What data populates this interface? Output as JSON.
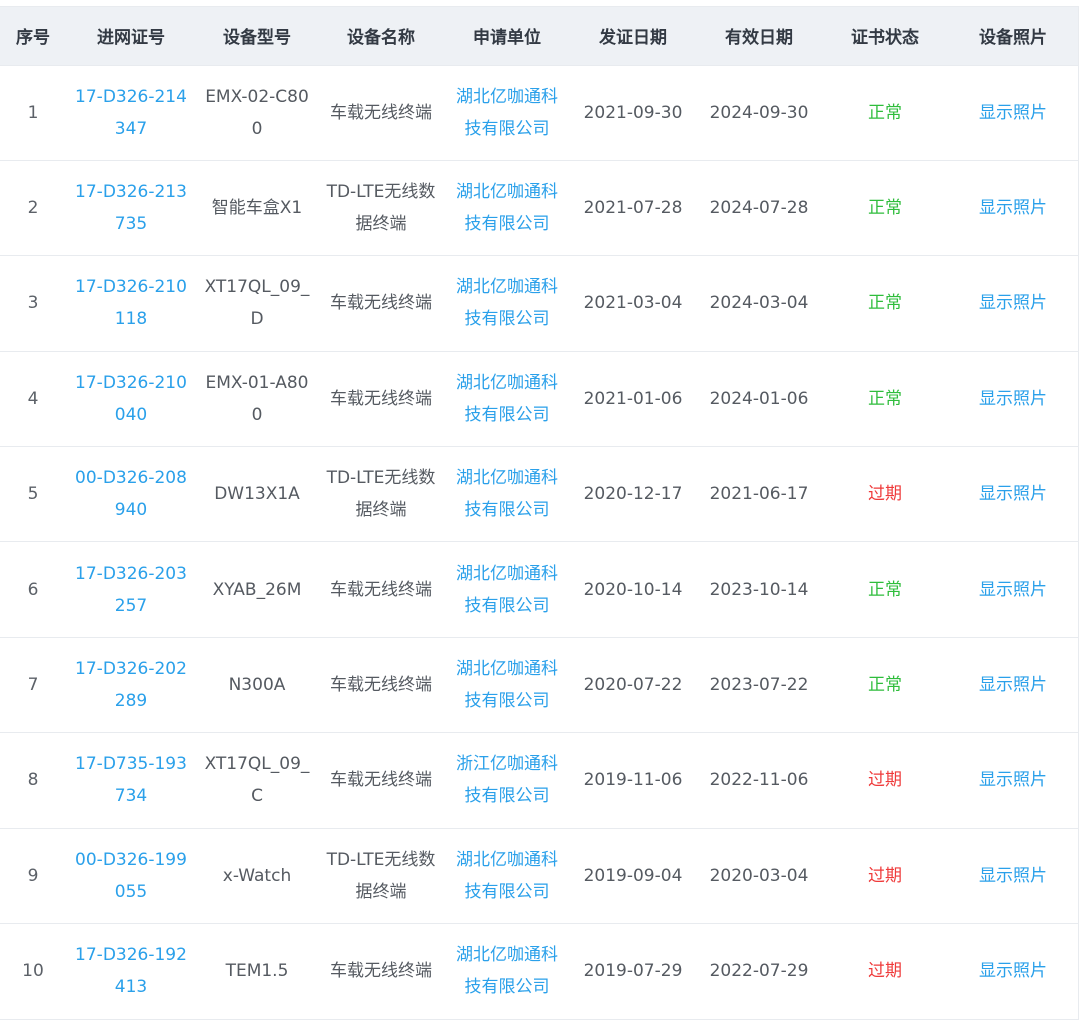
{
  "colors": {
    "link": "#2aa0ea",
    "status_normal": "#2fbd3c",
    "status_expired": "#ef3a3a",
    "header_bg": "#eef1f5"
  },
  "table": {
    "headers": [
      "序号",
      "进网证号",
      "设备型号",
      "设备名称",
      "申请单位",
      "发证日期",
      "有效日期",
      "证书状态",
      "设备照片"
    ],
    "rows": [
      {
        "idx": "1",
        "cert": "17-D326-214347",
        "model": "EMX-02-C800",
        "name": "车载无线终端",
        "org": "湖北亿咖通科技有限公司",
        "issued": "2021-09-30",
        "valid": "2024-09-30",
        "status": "正常",
        "status_type": "normal",
        "photo": "显示照片"
      },
      {
        "idx": "2",
        "cert": "17-D326-213735",
        "model": "智能车盒X1",
        "name": "TD-LTE无线数据终端",
        "org": "湖北亿咖通科技有限公司",
        "issued": "2021-07-28",
        "valid": "2024-07-28",
        "status": "正常",
        "status_type": "normal",
        "photo": "显示照片"
      },
      {
        "idx": "3",
        "cert": "17-D326-210118",
        "model": "XT17QL_09_D",
        "name": "车载无线终端",
        "org": "湖北亿咖通科技有限公司",
        "issued": "2021-03-04",
        "valid": "2024-03-04",
        "status": "正常",
        "status_type": "normal",
        "photo": "显示照片"
      },
      {
        "idx": "4",
        "cert": "17-D326-210040",
        "model": "EMX-01-A800",
        "name": "车载无线终端",
        "org": "湖北亿咖通科技有限公司",
        "issued": "2021-01-06",
        "valid": "2024-01-06",
        "status": "正常",
        "status_type": "normal",
        "photo": "显示照片"
      },
      {
        "idx": "5",
        "cert": "00-D326-208940",
        "model": "DW13X1A",
        "name": "TD-LTE无线数据终端",
        "org": "湖北亿咖通科技有限公司",
        "issued": "2020-12-17",
        "valid": "2021-06-17",
        "status": "过期",
        "status_type": "expired",
        "photo": "显示照片"
      },
      {
        "idx": "6",
        "cert": "17-D326-203257",
        "model": "XYAB_26M",
        "name": "车载无线终端",
        "org": "湖北亿咖通科技有限公司",
        "issued": "2020-10-14",
        "valid": "2023-10-14",
        "status": "正常",
        "status_type": "normal",
        "photo": "显示照片"
      },
      {
        "idx": "7",
        "cert": "17-D326-202289",
        "model": "N300A",
        "name": "车载无线终端",
        "org": "湖北亿咖通科技有限公司",
        "issued": "2020-07-22",
        "valid": "2023-07-22",
        "status": "正常",
        "status_type": "normal",
        "photo": "显示照片"
      },
      {
        "idx": "8",
        "cert": "17-D735-193734",
        "model": "XT17QL_09_C",
        "name": "车载无线终端",
        "org": "浙江亿咖通科技有限公司",
        "issued": "2019-11-06",
        "valid": "2022-11-06",
        "status": "过期",
        "status_type": "expired",
        "photo": "显示照片"
      },
      {
        "idx": "9",
        "cert": "00-D326-199055",
        "model": "x-Watch",
        "name": "TD-LTE无线数据终端",
        "org": "湖北亿咖通科技有限公司",
        "issued": "2019-09-04",
        "valid": "2020-03-04",
        "status": "过期",
        "status_type": "expired",
        "photo": "显示照片"
      },
      {
        "idx": "10",
        "cert": "17-D326-192413",
        "model": "TEM1.5",
        "name": "车载无线终端",
        "org": "湖北亿咖通科技有限公司",
        "issued": "2019-07-29",
        "valid": "2022-07-29",
        "status": "过期",
        "status_type": "expired",
        "photo": "显示照片"
      }
    ]
  }
}
